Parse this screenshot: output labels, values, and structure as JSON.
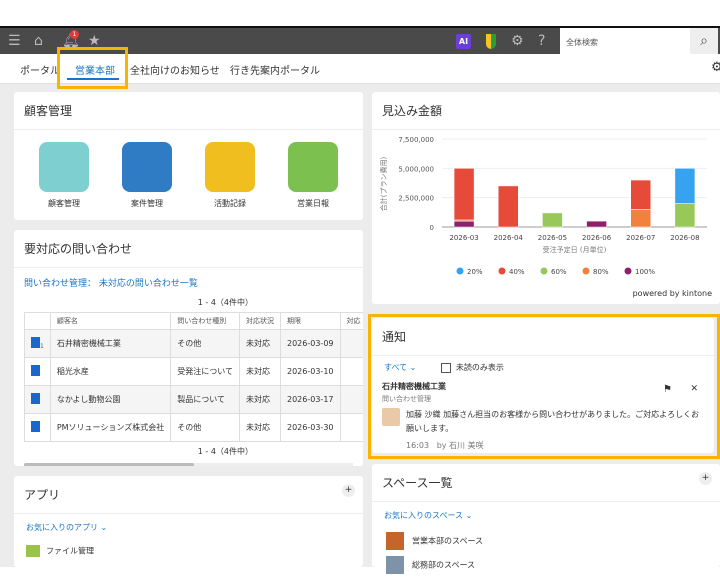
{
  "header": {
    "search_placeholder": "全体検索",
    "notification_count": "1",
    "ai_label": "AI"
  },
  "tabs": [
    "ポータル",
    "営業本部",
    "全社向けのお知らせ",
    "行き先案内ポータル"
  ],
  "customer": {
    "title": "顧客管理",
    "apps": [
      "顧客管理",
      "案件管理",
      "活動記録",
      "営業日報"
    ]
  },
  "inquiries": {
    "title": "要対応の問い合わせ",
    "link": "問い合わせ管理： 未対応の問い合わせ一覧",
    "count": "1 - 4（4件中）",
    "columns": [
      "顧客名",
      "問い合わせ種別",
      "対応状況",
      "期限",
      "対応"
    ],
    "rows": [
      [
        "石井精密機械工業",
        "その他",
        "未対応",
        "2026-03-09"
      ],
      [
        "稲光水産",
        "受発注について",
        "未対応",
        "2026-03-10"
      ],
      [
        "なかよし動物公園",
        "製品について",
        "未対応",
        "2026-03-17"
      ],
      [
        "PMソリューションズ株式会社",
        "その他",
        "未対応",
        "2026-03-30"
      ]
    ],
    "comment_badge": "1"
  },
  "apps_panel": {
    "title": "アプリ",
    "favorites": "お気に入りのアプリ",
    "items": [
      "ファイル管理"
    ]
  },
  "forecast": {
    "title": "見込み金額",
    "powered": "powered by kintone"
  },
  "chart_data": {
    "type": "bar",
    "stacked": true,
    "title": "見込み金額",
    "xlabel": "受注予定日 (月単位)",
    "ylabel": "合計(プラン費用)",
    "ylim": [
      0,
      7500000
    ],
    "yticks": [
      "0",
      "2,500,000",
      "5,000,000",
      "7,500,000"
    ],
    "categories": [
      "2026-03",
      "2026-04",
      "2026-05",
      "2026-06",
      "2026-07",
      "2026-08"
    ],
    "series": [
      {
        "name": "100%",
        "color": "#8e1f6d",
        "values": [
          500000,
          0,
          0,
          500000,
          0,
          0
        ]
      },
      {
        "name": "80%",
        "color": "#f2813d",
        "values": [
          100000,
          0,
          0,
          0,
          1500000,
          0
        ]
      },
      {
        "name": "60%",
        "color": "#97c859",
        "values": [
          0,
          0,
          1200000,
          0,
          0,
          2000000
        ]
      },
      {
        "name": "40%",
        "color": "#e84a3a",
        "values": [
          4400000,
          3500000,
          0,
          0,
          2500000,
          0
        ]
      },
      {
        "name": "20%",
        "color": "#36a3f0",
        "values": [
          0,
          0,
          0,
          0,
          0,
          3000000
        ]
      }
    ],
    "legend": [
      "20%",
      "40%",
      "60%",
      "80%",
      "100%"
    ],
    "legend_colors": [
      "#36a3f0",
      "#e84a3a",
      "#97c859",
      "#f2813d",
      "#8e1f6d"
    ]
  },
  "notice": {
    "title": "通知",
    "filter": "すべて",
    "unread_only": "未読のみ表示",
    "item": {
      "title": "石井精密機械工業",
      "app": "問い合わせ管理",
      "message": "加藤 沙織 加藤さん担当のお客様から問い合わせがありました。ご対応よろしくお願いします。",
      "time": "16:03",
      "by": "by 石川 美咲"
    }
  },
  "spaces": {
    "title": "スペース一覧",
    "favorites": "お気に入りのスペース",
    "items": [
      "営業本部のスペース",
      "総務部のスペース"
    ]
  }
}
